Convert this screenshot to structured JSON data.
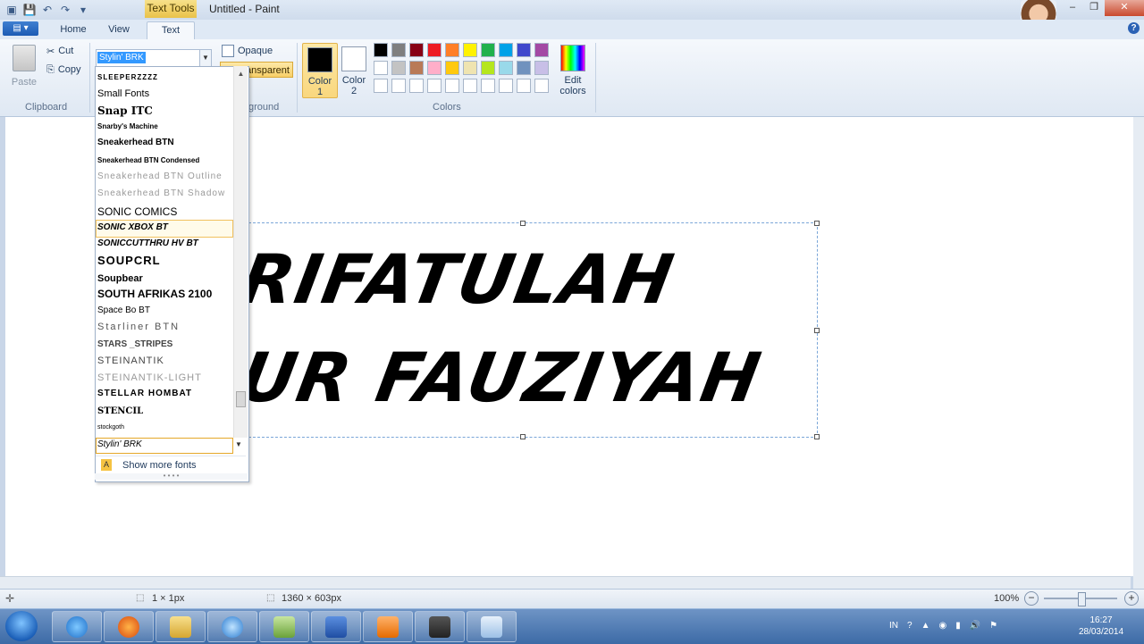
{
  "window": {
    "title": "Untitled - Paint",
    "context_tab": "Text Tools",
    "buttons": [
      "–",
      "❐",
      "✕"
    ]
  },
  "tabs": [
    "Home",
    "View",
    "Text"
  ],
  "active_tab": "Text",
  "ribbon": {
    "clipboard": {
      "paste": "Paste",
      "cut": "Cut",
      "copy": "Copy",
      "label": "Clipboard"
    },
    "font": {
      "current": "Stylin' BRK"
    },
    "background": {
      "opaque": "Opaque",
      "transparent": "Transparent",
      "label": "ground"
    },
    "colors": {
      "color1_label": "Color",
      "color1_num": "1",
      "color2_label": "Color",
      "color2_num": "2",
      "color1": "#000000",
      "color2": "#ffffff",
      "edit_label": "Edit",
      "edit_label2": "colors",
      "label": "Colors",
      "palette": [
        "#000000",
        "#7f7f7f",
        "#880015",
        "#ed1c24",
        "#ff7f27",
        "#fff200",
        "#22b14c",
        "#00a2e8",
        "#3f48cc",
        "#a349a4",
        "#ffffff",
        "#c3c3c3",
        "#b97a57",
        "#ffaec9",
        "#ffc90e",
        "#efe4b0",
        "#b5e61d",
        "#99d9ea",
        "#7092be",
        "#c8bfe7",
        "#ffffff",
        "#ffffff",
        "#ffffff",
        "#ffffff",
        "#ffffff",
        "#ffffff",
        "#ffffff",
        "#ffffff",
        "#ffffff",
        "#ffffff"
      ]
    }
  },
  "font_list": {
    "items": [
      "SLEEPERZZZZ",
      "Small Fonts",
      "Snap ITC",
      "Snarby's Machine",
      "Sneakerhead BTN",
      "Sneakerhead BTN Condensed",
      "Sneakerhead BTN Outline",
      "Sneakerhead BTN Shadow",
      "SONIC COMICS",
      "SONIC XBOX BT",
      "SONICCUTTHRU HV BT",
      "SOUPCRL",
      "Soupbear",
      "SOUTH AFRIKAS 2100",
      "Space Bo BT",
      "Starliner BTN",
      "STARS _STRIPES",
      "STEINANTIK",
      "STEINANTIK-LIGHT",
      "STELLAR HOMBAT",
      "STENCIL",
      "stockgoth",
      "Stylin' BRK"
    ],
    "show_more": "Show more fonts"
  },
  "canvas": {
    "line1": "ARIFATULAH",
    "line2": "NUR FAUZIYAH"
  },
  "statusbar": {
    "selection": "1 × 1px",
    "size": "1360 × 603px",
    "zoom": "100%"
  },
  "taskbar": {
    "lang": "IN",
    "time": "16:27",
    "date": "28/03/2014"
  }
}
